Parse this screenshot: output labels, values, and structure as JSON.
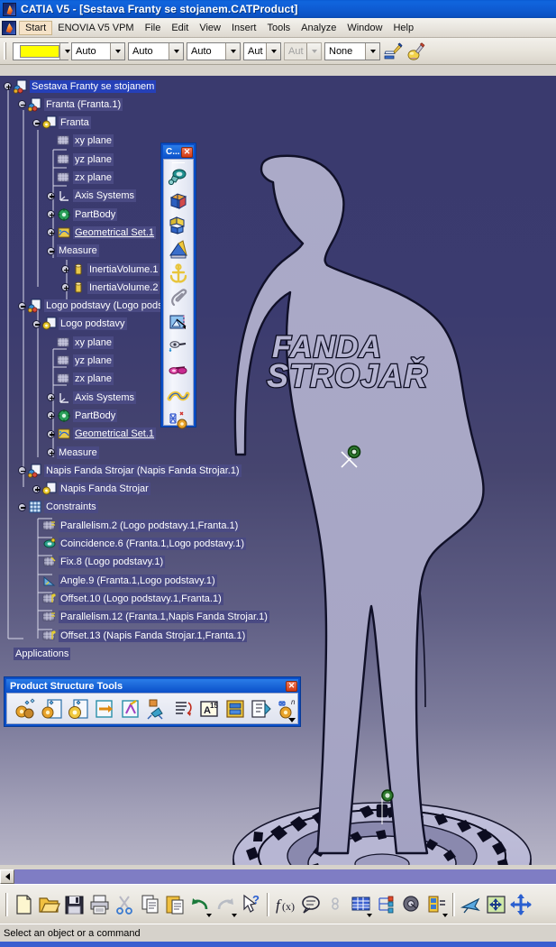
{
  "window": {
    "title": "CATIA V5 - [Sestava Franty se stojanem.CATProduct]",
    "app_icon": "catia-logo-icon"
  },
  "menubar": {
    "items": [
      {
        "label": "Start",
        "icon": "catia-logo-icon"
      },
      {
        "label": "ENOVIA V5 VPM"
      },
      {
        "label": "File"
      },
      {
        "label": "Edit"
      },
      {
        "label": "View"
      },
      {
        "label": "Insert"
      },
      {
        "label": "Tools"
      },
      {
        "label": "Analyze"
      },
      {
        "label": "Window"
      },
      {
        "label": "Help"
      }
    ]
  },
  "graphic_properties_toolbar": {
    "color_swatch": "#ffff00",
    "combos": [
      {
        "name": "fill-color",
        "value": "",
        "swatch": true,
        "disabled": false
      },
      {
        "name": "line-type",
        "value": "Auto",
        "disabled": false
      },
      {
        "name": "line-weight",
        "value": "Auto",
        "disabled": false
      },
      {
        "name": "point-symbol",
        "value": "Auto",
        "disabled": false
      },
      {
        "name": "layer",
        "value": "Aut",
        "disabled": false
      },
      {
        "name": "rendering-style",
        "value": "Aut",
        "disabled": true
      },
      {
        "name": "transparency",
        "value": "None",
        "disabled": false
      }
    ],
    "buttons": [
      {
        "name": "painter-icon",
        "label": "Painter"
      },
      {
        "name": "apply-material-icon",
        "label": "Apply Material"
      }
    ]
  },
  "tree": {
    "nodes": [
      {
        "label": "Sestava Franty se stojanem",
        "depth": 0,
        "icon": "product-icon",
        "expander": "plus",
        "selected": true,
        "underline": false
      },
      {
        "label": "Franta (Franta.1)",
        "depth": 1,
        "icon": "part-instance-icon",
        "expander": "minus",
        "selected": false,
        "underline": false
      },
      {
        "label": "Franta",
        "depth": 2,
        "icon": "part-icon",
        "expander": "minus",
        "selected": false,
        "underline": false
      },
      {
        "label": "xy plane",
        "depth": 3,
        "icon": "plane-icon",
        "expander": "none",
        "selected": false,
        "underline": false
      },
      {
        "label": "yz plane",
        "depth": 3,
        "icon": "plane-icon",
        "expander": "none",
        "selected": false,
        "underline": false
      },
      {
        "label": "zx plane",
        "depth": 3,
        "icon": "plane-icon",
        "expander": "none",
        "selected": false,
        "underline": false
      },
      {
        "label": "Axis Systems",
        "depth": 3,
        "icon": "axis-system-icon",
        "expander": "plus",
        "selected": false,
        "underline": false
      },
      {
        "label": "PartBody",
        "depth": 3,
        "icon": "partbody-icon",
        "expander": "plus",
        "selected": false,
        "underline": false
      },
      {
        "label": "Geometrical Set.1",
        "depth": 3,
        "icon": "geometrical-set-icon",
        "expander": "plus",
        "selected": false,
        "underline": true
      },
      {
        "label": "Measure",
        "depth": 3,
        "icon": "none",
        "expander": "minus",
        "selected": false,
        "underline": false
      },
      {
        "label": "InertiaVolume.1",
        "depth": 4,
        "icon": "inertia-icon",
        "expander": "plus",
        "selected": false,
        "underline": false
      },
      {
        "label": "InertiaVolume.2",
        "depth": 4,
        "icon": "inertia-icon",
        "expander": "plus",
        "selected": false,
        "underline": false
      },
      {
        "label": "Logo podstavy (Logo podstav",
        "depth": 1,
        "icon": "part-instance-icon",
        "expander": "minus",
        "selected": false,
        "underline": false
      },
      {
        "label": "Logo podstavy",
        "depth": 2,
        "icon": "part-icon",
        "expander": "minus",
        "selected": false,
        "underline": false
      },
      {
        "label": "xy plane",
        "depth": 3,
        "icon": "plane-icon",
        "expander": "none",
        "selected": false,
        "underline": false
      },
      {
        "label": "yz plane",
        "depth": 3,
        "icon": "plane-icon",
        "expander": "none",
        "selected": false,
        "underline": false
      },
      {
        "label": "zx plane",
        "depth": 3,
        "icon": "plane-icon",
        "expander": "none",
        "selected": false,
        "underline": false
      },
      {
        "label": "Axis Systems",
        "depth": 3,
        "icon": "axis-system-icon",
        "expander": "plus",
        "selected": false,
        "underline": false
      },
      {
        "label": "PartBody",
        "depth": 3,
        "icon": "partbody-icon",
        "expander": "plus",
        "selected": false,
        "underline": false
      },
      {
        "label": "Geometrical Set.1",
        "depth": 3,
        "icon": "geometrical-set-icon",
        "expander": "plus",
        "selected": false,
        "underline": true
      },
      {
        "label": "Measure",
        "depth": 3,
        "icon": "none",
        "expander": "plus",
        "selected": false,
        "underline": false
      },
      {
        "label": "Napis Fanda Strojar (Napis Fanda Strojar.1)",
        "depth": 1,
        "icon": "part-instance-icon",
        "expander": "minus",
        "selected": false,
        "underline": false
      },
      {
        "label": "Napis Fanda Strojar",
        "depth": 2,
        "icon": "part-icon",
        "expander": "plus",
        "selected": false,
        "underline": false
      },
      {
        "label": "Constraints",
        "depth": 1,
        "icon": "constraints-icon",
        "expander": "minus",
        "selected": false,
        "underline": false
      },
      {
        "label": "Parallelism.2 (Logo podstavy.1,Franta.1)",
        "depth": 2,
        "icon": "parallelism-icon",
        "expander": "none",
        "selected": false,
        "underline": false
      },
      {
        "label": "Coincidence.6 (Franta.1,Logo podstavy.1)",
        "depth": 2,
        "icon": "coincidence-icon",
        "expander": "none",
        "selected": false,
        "underline": false
      },
      {
        "label": "Fix.8 (Logo podstavy.1)",
        "depth": 2,
        "icon": "fix-icon",
        "expander": "none",
        "selected": false,
        "underline": false
      },
      {
        "label": "Angle.9 (Franta.1,Logo podstavy.1)",
        "depth": 2,
        "icon": "angle-icon",
        "expander": "none",
        "selected": false,
        "underline": false
      },
      {
        "label": "Offset.10 (Logo podstavy.1,Franta.1)",
        "depth": 2,
        "icon": "offset-icon",
        "expander": "none",
        "selected": false,
        "underline": false
      },
      {
        "label": "Parallelism.12 (Franta.1,Napis Fanda Strojar.1)",
        "depth": 2,
        "icon": "parallelism-icon",
        "expander": "none",
        "selected": false,
        "underline": false
      },
      {
        "label": "Offset.13 (Napis Fanda Strojar.1,Franta.1)",
        "depth": 2,
        "icon": "offset-icon",
        "expander": "none",
        "selected": false,
        "underline": false
      },
      {
        "label": "Applications",
        "depth": 0,
        "icon": "none",
        "expander": "none",
        "selected": false,
        "underline": false
      }
    ]
  },
  "floating_toolbar": {
    "title": "C...",
    "close_label": "✕",
    "buttons": [
      {
        "name": "manipulation-icon",
        "label": "Manipulation"
      },
      {
        "name": "explode-icon",
        "label": "Explode"
      },
      {
        "name": "clash-detection-icon",
        "label": "Clash Detection"
      },
      {
        "name": "sectioning-icon",
        "label": "Sectioning"
      },
      {
        "name": "anchor-icon",
        "label": "Anchor"
      },
      {
        "name": "annotation-clip-icon",
        "label": "Annotated View"
      },
      {
        "name": "scene-icon",
        "label": "Enhanced Scene"
      },
      {
        "name": "simple-track-icon",
        "label": "Simple Track"
      },
      {
        "name": "track-shuttle-icon",
        "label": "Track Shuttle"
      },
      {
        "name": "swept-volume-icon",
        "label": "Swept Volume"
      },
      {
        "name": "analysis-icon",
        "label": "Analysis"
      }
    ]
  },
  "product_structure_tools": {
    "title": "Product Structure Tools",
    "close_label": "✕",
    "buttons": [
      {
        "name": "new-component-icon",
        "label": "New Component"
      },
      {
        "name": "new-product-icon",
        "label": "New Product"
      },
      {
        "name": "new-part-icon",
        "label": "New Part"
      },
      {
        "name": "existing-component-icon",
        "label": "Existing Component"
      },
      {
        "name": "replace-component-icon",
        "label": "Replace Component"
      },
      {
        "name": "graph-tree-reorder-icon",
        "label": "Graph Tree Reordering"
      },
      {
        "name": "generate-numbering-icon",
        "label": "Generate Numbering"
      },
      {
        "name": "selective-load-icon",
        "label": "Selective Load"
      },
      {
        "name": "manage-representations-icon",
        "label": "Manage Representations"
      },
      {
        "name": "multi-instantiation-icon",
        "label": "Multi Instantiation"
      },
      {
        "name": "fast-multi-instantiation-icon",
        "label": "Fast Multi Instantiation"
      }
    ]
  },
  "bottom_toolbar": {
    "buttons": [
      {
        "name": "new-document-icon",
        "label": "New",
        "dropdown": false
      },
      {
        "name": "open-folder-icon",
        "label": "Open",
        "dropdown": false
      },
      {
        "name": "save-icon",
        "label": "Save",
        "dropdown": false
      },
      {
        "name": "print-icon",
        "label": "Print",
        "dropdown": false
      },
      {
        "name": "cut-scissors-icon",
        "label": "Cut",
        "dropdown": false
      },
      {
        "name": "copy-icon",
        "label": "Copy",
        "dropdown": false
      },
      {
        "name": "paste-icon",
        "label": "Paste",
        "dropdown": false
      },
      {
        "name": "undo-icon",
        "label": "Undo",
        "dropdown": true
      },
      {
        "name": "redo-icon",
        "label": "Redo",
        "dropdown": true
      },
      {
        "name": "whats-this-help-icon",
        "label": "What's This",
        "dropdown": false
      },
      {
        "name": "formula-icon",
        "label": "Formula",
        "dropdown": false
      },
      {
        "name": "comment-icon",
        "label": "Comment",
        "dropdown": false
      },
      {
        "name": "constraint-icon",
        "label": "Constraint",
        "dropdown": false
      },
      {
        "name": "design-table-icon",
        "label": "Design Table",
        "dropdown": true
      },
      {
        "name": "knowledge-icon",
        "label": "Knowledge",
        "dropdown": false
      },
      {
        "name": "lock-icon",
        "label": "Lock",
        "dropdown": false
      },
      {
        "name": "measure-item-icon",
        "label": "Measure Item",
        "dropdown": true
      },
      {
        "name": "fly-mode-icon",
        "label": "Fly Mode",
        "dropdown": false
      },
      {
        "name": "fit-all-in-icon",
        "label": "Fit All In",
        "dropdown": false
      },
      {
        "name": "pan-icon",
        "label": "Pan",
        "dropdown": false
      }
    ]
  },
  "scrollbar": {
    "left_arrow": "scroll-left-arrow-icon"
  },
  "statusbar": {
    "message": "Select an object or a command"
  },
  "viewport": {
    "model_name": "Franta figure on gear base",
    "logo_line1": "FANDA",
    "logo_line2": "STROJAŘ",
    "background_top_color": "#3a3a6e",
    "background_bottom_color": "#b6b4c6",
    "body_color": "#a9a8c6",
    "edge_color": "#101028",
    "axis_marker_color": "#2f7a2f"
  }
}
